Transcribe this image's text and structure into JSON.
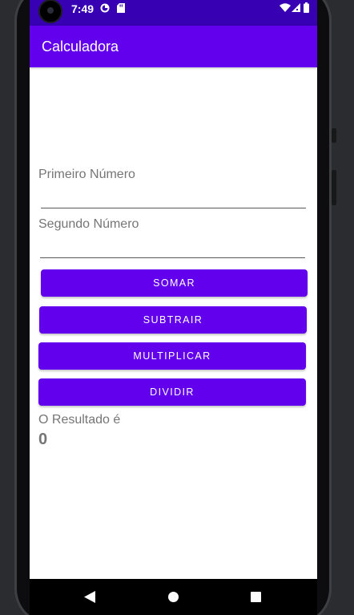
{
  "status_bar": {
    "time": "7:49",
    "icons": [
      "camera-icon",
      "circle-app-icon",
      "sd-card-icon",
      "wifi-icon",
      "signal-icon",
      "battery-icon"
    ],
    "background": "#3700b3"
  },
  "app_bar": {
    "title": "Calculadora",
    "background": "#6200ee"
  },
  "form": {
    "first_label": "Primeiro Número",
    "first_value": "",
    "second_label": "Segundo Número",
    "second_value": ""
  },
  "buttons": {
    "add": "SOMAR",
    "subtract": "SUBTRAIR",
    "multiply": "MULTIPLICAR",
    "divide": "DIVIDIR",
    "color": "#6200ee"
  },
  "result": {
    "label": "O Resultado é",
    "value": "0"
  },
  "nav_bar": {
    "icons": [
      "back-icon",
      "home-icon",
      "recents-icon"
    ]
  }
}
